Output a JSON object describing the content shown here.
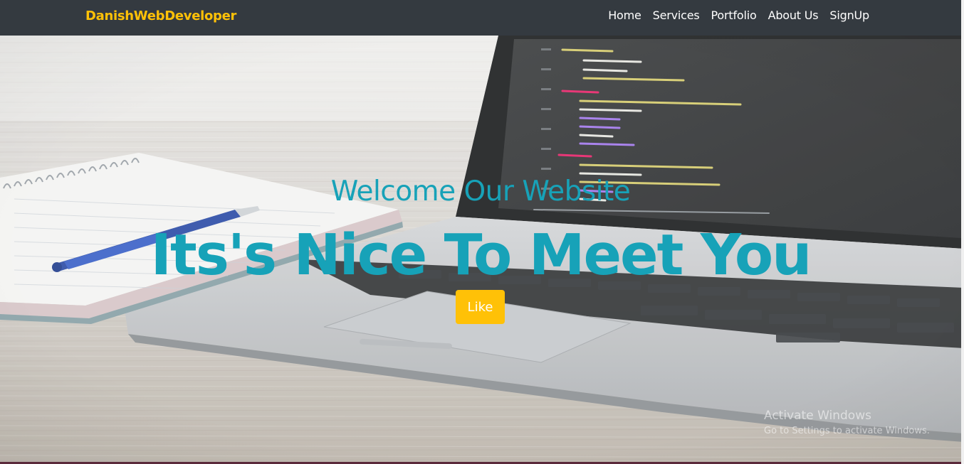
{
  "navbar": {
    "brand": "DanishWebDeveloper",
    "links": [
      "Home",
      "Services",
      "Portfolio",
      "About Us",
      "SignUp"
    ]
  },
  "hero": {
    "welcome": "Welcome Our Website",
    "headline": "Its's Nice To Meet You",
    "button_label": "Like"
  },
  "watermark": {
    "title": "Activate Windows",
    "subtitle": "Go to Settings to activate Windows."
  },
  "colors": {
    "navbar_bg": "#343a40",
    "brand": "#ffc107",
    "accent_teal": "#17a2b8",
    "button": "#ffc107"
  },
  "icons": [
    "notebook-illustration",
    "pen-illustration",
    "laptop-illustration"
  ]
}
